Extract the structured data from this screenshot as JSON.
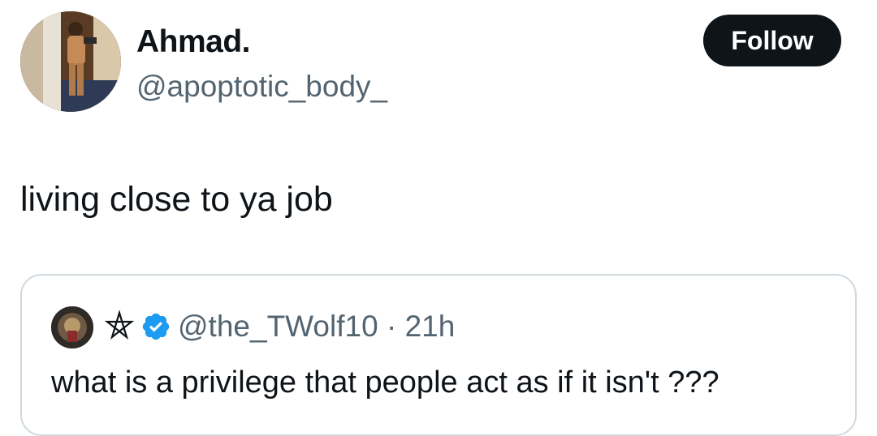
{
  "tweet": {
    "author": {
      "display_name": "Ahmad.",
      "handle": "@apoptotic_body_"
    },
    "follow_label": "Follow",
    "text": "living close to ya job"
  },
  "quoted_tweet": {
    "name_symbol": "pentagram-symbol",
    "verified": true,
    "handle": "@the_TWolf10",
    "separator": "·",
    "time_ago": "21h",
    "text": "what is a privilege that people act as if it isn't ???"
  },
  "colors": {
    "text_primary": "#0f1419",
    "text_secondary": "#536471",
    "follow_bg": "#0f1419",
    "verified_blue": "#1d9bf0",
    "card_border": "#cfd9de"
  }
}
